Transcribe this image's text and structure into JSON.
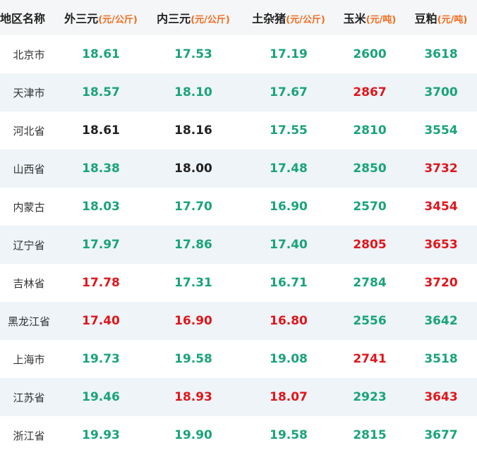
{
  "header": {
    "region": "地区名称",
    "columns": [
      {
        "label": "外三元",
        "unit": "(元/公斤)"
      },
      {
        "label": "内三元",
        "unit": "(元/公斤)"
      },
      {
        "label": "土杂猪",
        "unit": "(元/公斤)"
      },
      {
        "label": "玉米",
        "unit": "(元/吨)"
      },
      {
        "label": "豆粕",
        "unit": "(元/吨)"
      }
    ]
  },
  "colors": {
    "green": "#1aa37a",
    "red": "#e0161b",
    "black": "#222222",
    "unit": "#f26b1d"
  },
  "rows": [
    {
      "region": "北京市",
      "values": [
        [
          "18.61",
          "green"
        ],
        [
          "17.53",
          "green"
        ],
        [
          "17.19",
          "green"
        ],
        [
          "2600",
          "green"
        ],
        [
          "3618",
          "green"
        ]
      ]
    },
    {
      "region": "天津市",
      "values": [
        [
          "18.57",
          "green"
        ],
        [
          "18.10",
          "green"
        ],
        [
          "17.67",
          "green"
        ],
        [
          "2867",
          "red"
        ],
        [
          "3700",
          "green"
        ]
      ]
    },
    {
      "region": "河北省",
      "values": [
        [
          "18.61",
          "black"
        ],
        [
          "18.16",
          "black"
        ],
        [
          "17.55",
          "green"
        ],
        [
          "2810",
          "green"
        ],
        [
          "3554",
          "green"
        ]
      ]
    },
    {
      "region": "山西省",
      "values": [
        [
          "18.38",
          "green"
        ],
        [
          "18.00",
          "black"
        ],
        [
          "17.48",
          "green"
        ],
        [
          "2850",
          "green"
        ],
        [
          "3732",
          "red"
        ]
      ]
    },
    {
      "region": "内蒙古",
      "values": [
        [
          "18.03",
          "green"
        ],
        [
          "17.70",
          "green"
        ],
        [
          "16.90",
          "green"
        ],
        [
          "2570",
          "green"
        ],
        [
          "3454",
          "red"
        ]
      ]
    },
    {
      "region": "辽宁省",
      "values": [
        [
          "17.97",
          "green"
        ],
        [
          "17.86",
          "green"
        ],
        [
          "17.40",
          "green"
        ],
        [
          "2805",
          "red"
        ],
        [
          "3653",
          "red"
        ]
      ]
    },
    {
      "region": "吉林省",
      "values": [
        [
          "17.78",
          "red"
        ],
        [
          "17.31",
          "green"
        ],
        [
          "16.71",
          "green"
        ],
        [
          "2784",
          "green"
        ],
        [
          "3720",
          "red"
        ]
      ]
    },
    {
      "region": "黑龙江省",
      "values": [
        [
          "17.40",
          "red"
        ],
        [
          "16.90",
          "red"
        ],
        [
          "16.80",
          "red"
        ],
        [
          "2556",
          "green"
        ],
        [
          "3642",
          "green"
        ]
      ]
    },
    {
      "region": "上海市",
      "values": [
        [
          "19.73",
          "green"
        ],
        [
          "19.58",
          "green"
        ],
        [
          "19.08",
          "green"
        ],
        [
          "2741",
          "red"
        ],
        [
          "3518",
          "green"
        ]
      ]
    },
    {
      "region": "江苏省",
      "values": [
        [
          "19.46",
          "green"
        ],
        [
          "18.93",
          "red"
        ],
        [
          "18.07",
          "red"
        ],
        [
          "2923",
          "green"
        ],
        [
          "3643",
          "red"
        ]
      ]
    },
    {
      "region": "浙江省",
      "values": [
        [
          "19.93",
          "green"
        ],
        [
          "19.90",
          "green"
        ],
        [
          "19.58",
          "green"
        ],
        [
          "2815",
          "green"
        ],
        [
          "3677",
          "green"
        ]
      ]
    }
  ]
}
